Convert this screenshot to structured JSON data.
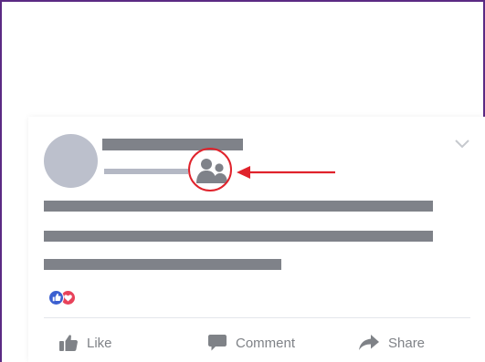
{
  "actions": {
    "like_label": "Like",
    "comment_label": "Comment",
    "share_label": "Share"
  },
  "icons": {
    "audience": "friends-icon",
    "menu": "chevron-down-icon",
    "reaction_like": "thumbs-up-icon",
    "reaction_love": "heart-icon",
    "like": "thumbs-up-icon",
    "comment": "comment-bubble-icon",
    "share": "share-arrow-icon"
  },
  "colors": {
    "frame_border": "#5b2a83",
    "avatar": "#bcc0cc",
    "name_skeleton": "#7f8289",
    "meta_skeleton": "#b4b8c4",
    "text_skeleton": "#7f8289",
    "audience_icon": "#7f8289",
    "annotation": "#e0232c",
    "reaction_like": "#3b5fd0",
    "reaction_love": "#e8425a",
    "action_gray": "#7f8287"
  }
}
